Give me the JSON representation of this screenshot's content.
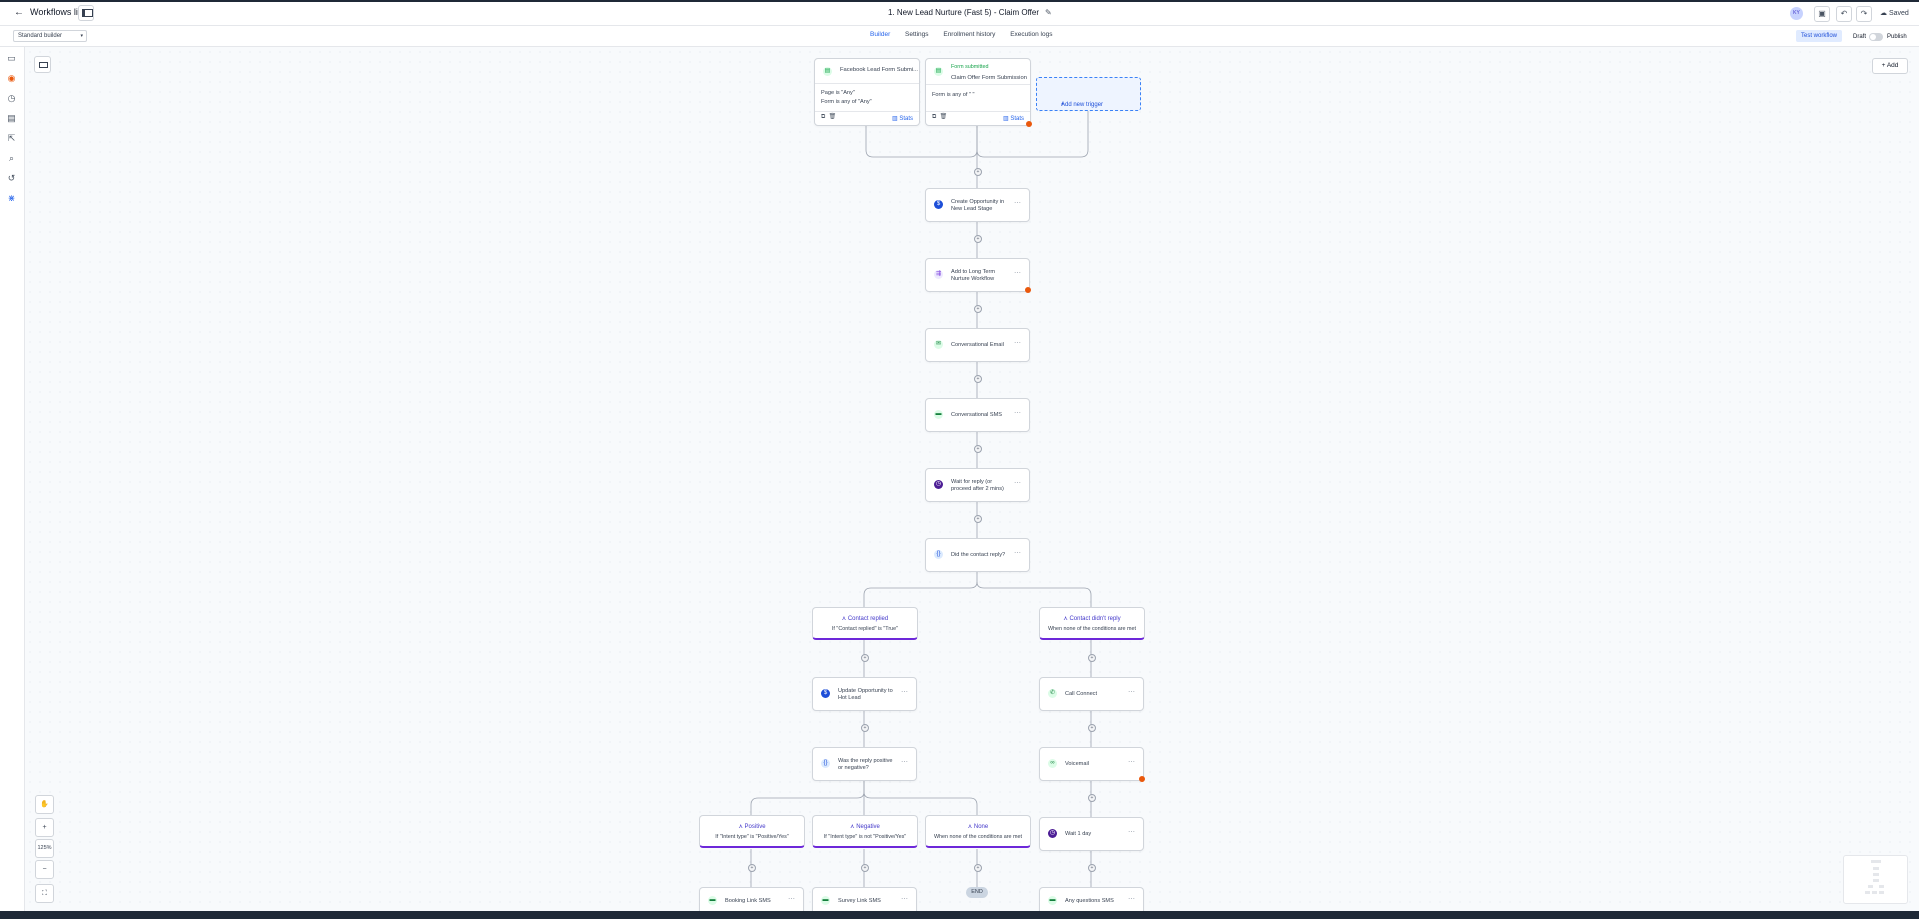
{
  "header": {
    "back_label": "Workflows list",
    "workflow_title": "1. New Lead Nurture (Fast 5) - Claim Offer",
    "avatar_initials": "KY",
    "save_status": "Saved"
  },
  "subbar": {
    "builder_mode": "Standard builder",
    "tabs": [
      "Builder",
      "Settings",
      "Enrollment history",
      "Execution logs"
    ],
    "active_tab": "Builder",
    "test_label": "Test workflow",
    "draft_label": "Draft",
    "publish_label": "Publish",
    "published": false
  },
  "canvas": {
    "add_label": "Add",
    "zoom_level": "125%"
  },
  "triggers": [
    {
      "title": "Facebook Lead Form Submi...",
      "conditions": [
        "Page is \"Any\"",
        "Form is any of \"Any\""
      ],
      "stats_label": "Stats",
      "has_error": false
    },
    {
      "subtitle": "Form submitted",
      "title": "Claim Offer Form Submission",
      "conditions": [
        "Form is any of \" \""
      ],
      "stats_label": "Stats",
      "has_error": true
    }
  ],
  "add_trigger_label": "Add new trigger",
  "actions": {
    "create_opportunity": "Create Opportunity in New Lead Stage",
    "add_to_workflow": "Add to Long Term Nurture Workflow",
    "conversational_email": "Conversational Email",
    "conversational_sms": "Conversational SMS",
    "wait_reply": "Wait for reply (or proceed after 2 mins)",
    "did_reply": "Did the contact reply?",
    "update_opportunity": "Update Opportunity to Hot Lead",
    "was_positive": "Was the reply positive or negative?",
    "call_connect": "Call Connect",
    "voicemail": "Voicemail",
    "wait_1_day": "Wait 1 day",
    "booking_sms": "Booking Link SMS",
    "survey_sms": "Survey Link SMS",
    "questions_sms": "Any questions SMS"
  },
  "branches": {
    "replied": {
      "title": "Contact replied",
      "condition": "If \"Contact replied\" is \"True\""
    },
    "not_replied": {
      "title": "Contact didn't reply",
      "condition": "When none of the conditions are met"
    },
    "positive": {
      "title": "Positive",
      "condition": "If \"Intent type\" is \"Positive/Yes\""
    },
    "negative": {
      "title": "Negative",
      "condition": "If \"Intent type\" is not \"Positive/Yes\""
    },
    "none": {
      "title": "None",
      "condition": "When none of the conditions are met"
    }
  },
  "end_label": "END",
  "icons": {
    "back": "arrow-left-icon",
    "edit": "pencil-icon",
    "undo": "undo-icon",
    "redo": "redo-icon",
    "cloud": "cloud-check-icon",
    "branch": "branch-icon"
  },
  "colors": {
    "accent": "#2563eb",
    "branch_underline": "#6d28d9",
    "error": "#ea580c",
    "trigger_green": "#16a34a"
  }
}
